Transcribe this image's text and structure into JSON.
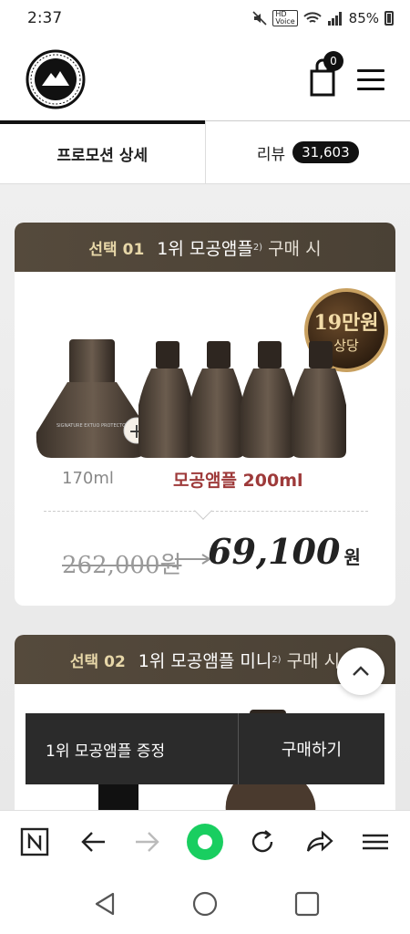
{
  "status_bar": {
    "time": "2:37",
    "hd_label": "HD\nVoice",
    "signal": "4G",
    "battery": "85%"
  },
  "header": {
    "logo_text": "GEMAFI",
    "cart_count": "0"
  },
  "tabs": [
    {
      "label": "프로모션 상세",
      "active": true
    },
    {
      "label": "리뷰",
      "count": "31,603",
      "active": false
    }
  ],
  "card1": {
    "select_label": "선택 01",
    "title": "1위 모공앰플",
    "sup": "2)",
    "title_suffix": "구매 시",
    "badge_line1": "19만원",
    "badge_line2": "상당",
    "left_label": "170ml",
    "right_label": "모공앰플 200ml",
    "price_old": "262,000원",
    "price_new": "69,100",
    "price_unit": "원"
  },
  "card2": {
    "select_label": "선택 02",
    "title": "1위 모공앰플 미니",
    "sup": "2)",
    "title_suffix": "구매 시"
  },
  "buy_bar": {
    "gift_label": "1위 모공앰플 증정",
    "buy_label": "구매하기"
  },
  "colors": {
    "card_head": "#4f4539",
    "accent_gold": "#e7d7a8",
    "price_red": "#9e3a3a",
    "browser_green": "#19ce60"
  }
}
